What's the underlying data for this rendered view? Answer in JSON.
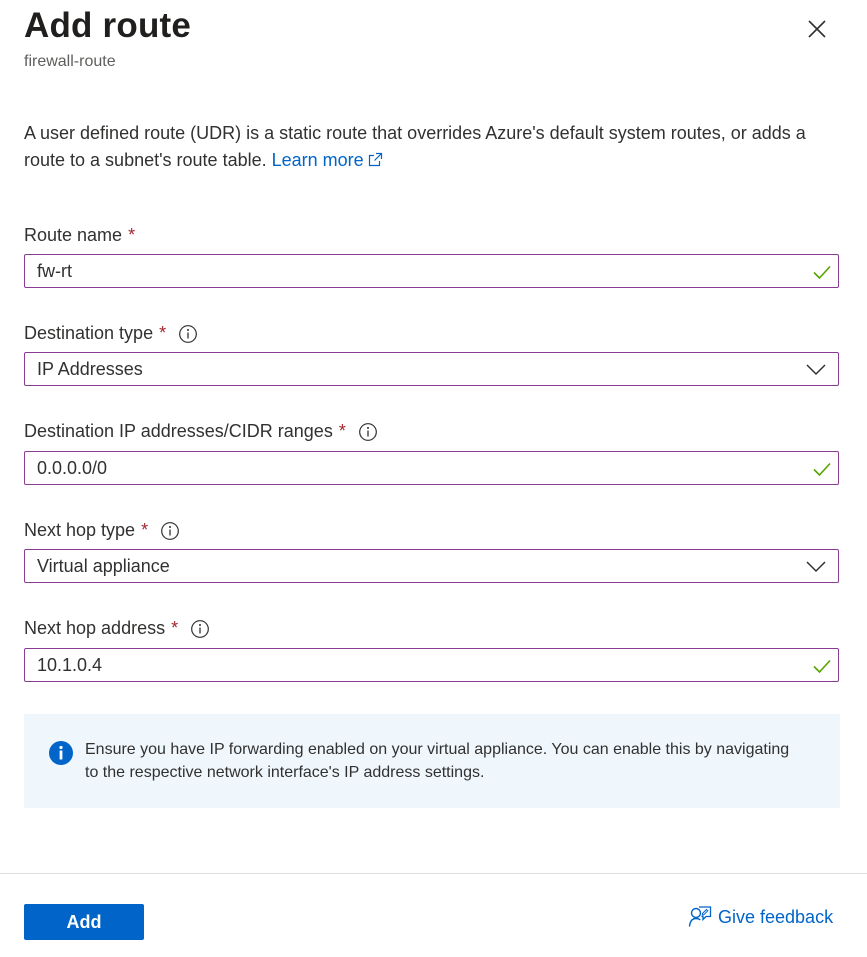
{
  "header": {
    "title": "Add route",
    "subtitle": "firewall-route"
  },
  "description": {
    "text": "A user defined route (UDR) is a static route that overrides Azure's default system routes, or adds a route to a subnet's route table.",
    "link_label": "Learn more"
  },
  "fields": {
    "route_name": {
      "label": "Route name",
      "value": "fw-rt",
      "required": "*"
    },
    "destination_type": {
      "label": "Destination type",
      "value": "IP Addresses",
      "required": "*"
    },
    "destination_ip": {
      "label": "Destination IP addresses/CIDR ranges",
      "value": "0.0.0.0/0",
      "required": "*"
    },
    "next_hop_type": {
      "label": "Next hop type",
      "value": "Virtual appliance",
      "required": "*"
    },
    "next_hop_address": {
      "label": "Next hop address",
      "value": "10.1.0.4",
      "required": "*"
    }
  },
  "info_message": "Ensure you have IP forwarding enabled on your virtual appliance. You can enable this by navigating to the respective network interface's IP address settings.",
  "footer": {
    "add_label": "Add",
    "feedback_label": "Give feedback"
  },
  "colors": {
    "accent": "#0064c8",
    "valid": "#57a300",
    "required": "#a4262c",
    "input_border": "#8a3d92"
  },
  "icons": [
    "close-icon",
    "external-link-icon",
    "info-icon",
    "checkmark-icon",
    "chevron-down-icon",
    "feedback-icon"
  ]
}
